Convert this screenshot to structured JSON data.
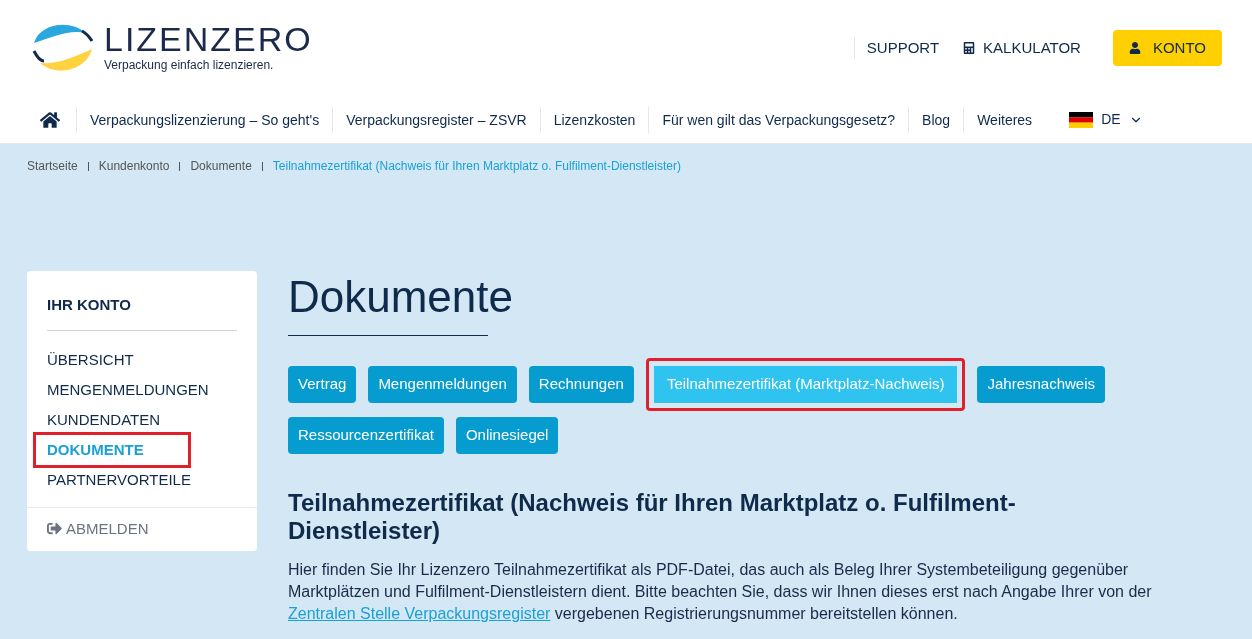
{
  "logo": {
    "name": "LIZENZERO",
    "tagline": "Verpackung einfach lizenzieren."
  },
  "top_links": [
    {
      "label": "SUPPORT",
      "kind": "plain"
    },
    {
      "label": "KALKULATOR",
      "kind": "calculator"
    },
    {
      "label": "KONTO",
      "kind": "account"
    }
  ],
  "nav": {
    "items": [
      "Verpackungslizenzierung – So geht's",
      "Verpackungsregister – ZSVR",
      "Lizenzkosten",
      "Für wen gilt das Verpackungsgesetz?",
      "Blog",
      "Weiteres"
    ],
    "language": "DE"
  },
  "breadcrumb": [
    {
      "label": "Startseite",
      "selected": false
    },
    {
      "label": "Kundenkonto",
      "selected": false
    },
    {
      "label": "Dokumente",
      "selected": false
    },
    {
      "label": "Teilnahmezertifikat (Nachweis für Ihren Marktplatz o. Fulfilment-Dienstleister)",
      "selected": true
    }
  ],
  "sidebar": {
    "title": "IHR KONTO",
    "items": [
      {
        "label": "ÜBERSICHT",
        "selected": false,
        "highlighted": false
      },
      {
        "label": "MENGENMELDUNGEN",
        "selected": false,
        "highlighted": false
      },
      {
        "label": "KUNDENDATEN",
        "selected": false,
        "highlighted": false
      },
      {
        "label": "DOKUMENTE",
        "selected": true,
        "highlighted": true
      },
      {
        "label": "PARTNERVORTEILE",
        "selected": false,
        "highlighted": false
      }
    ],
    "logout": "ABMELDEN"
  },
  "page_title": "Dokumente",
  "tabs": [
    {
      "label": "Vertrag",
      "selected": false,
      "highlighted": false
    },
    {
      "label": "Mengenmeldungen",
      "selected": false,
      "highlighted": false
    },
    {
      "label": "Rechnungen",
      "selected": false,
      "highlighted": false
    },
    {
      "label": "Teilnahmezertifikat (Marktplatz-Nachweis)",
      "selected": true,
      "highlighted": true
    },
    {
      "label": "Jahresnachweis",
      "selected": false,
      "highlighted": false
    },
    {
      "label": "Ressourcenzertifikat",
      "selected": false,
      "highlighted": false
    },
    {
      "label": "Onlinesiegel",
      "selected": false,
      "highlighted": false
    }
  ],
  "section": {
    "heading": "Teilnahmezertifikat (Nachweis für Ihren Marktplatz o. Fulfilment-Dienstleister)",
    "text": "Hier finden Sie Ihr Lizenzero Teilnahmezertifikat als PDF-Datei, das auch als Beleg Ihrer Systembeteiligung gegenüber Marktplätzen und Fulfilment-Dienstleistern dient. Bitte beachten Sie, dass wir Ihnen dieses erst nach Angabe Ihrer von der",
    "link": "Zentralen Stelle Verpackungsregister",
    "text_after": "vergebenen Registrierungsnummer bereitstellen können."
  }
}
